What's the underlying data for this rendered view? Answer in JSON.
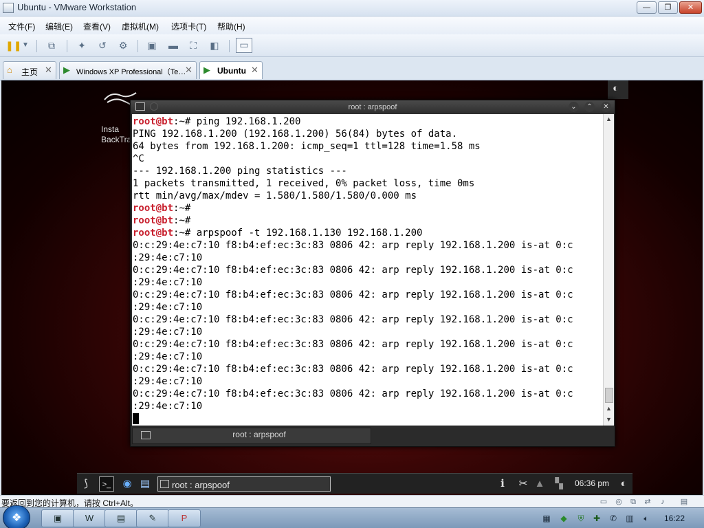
{
  "window": {
    "title": "Ubuntu - VMware Workstation",
    "minimize_glyph": "—",
    "maximize_glyph": "❐",
    "close_glyph": "✕"
  },
  "menu": [
    "文件(F)",
    "编辑(E)",
    "查看(V)",
    "虚拟机(M)",
    "选项卡(T)",
    "帮助(H)"
  ],
  "toolbar": {
    "icons": [
      "pause-icon",
      "dropdown-icon",
      "network-icon",
      "snapshot-icon",
      "revert-snapshot-icon",
      "snapshot-manager-icon",
      "sidebar-icon",
      "console-view-icon",
      "fullscreen-icon",
      "unity-icon",
      "thumbnail-icon"
    ]
  },
  "tabs": [
    {
      "label": "主页",
      "icon": "home-icon",
      "close": "✕"
    },
    {
      "label": "Windows XP Professional（Te…",
      "icon": "vm-icon",
      "close": "✕"
    },
    {
      "label": "Ubuntu",
      "icon": "vm-icon",
      "close": "✕",
      "active": true
    }
  ],
  "desktop": {
    "label_line1": "Insta",
    "label_line2": "BackTra"
  },
  "terminal": {
    "title": "root : arpspoof",
    "tab_label": "root : arpspoof",
    "lines": [
      {
        "prompt": "root@bt",
        "rest": ":~# ping 192.168.1.200"
      },
      {
        "text": "PING 192.168.1.200 (192.168.1.200) 56(84) bytes of data."
      },
      {
        "text": "64 bytes from 192.168.1.200: icmp_seq=1 ttl=128 time=1.58 ms"
      },
      {
        "text": "^C"
      },
      {
        "text": "--- 192.168.1.200 ping statistics ---"
      },
      {
        "text": "1 packets transmitted, 1 received, 0% packet loss, time 0ms"
      },
      {
        "text": "rtt min/avg/max/mdev = 1.580/1.580/1.580/0.000 ms"
      },
      {
        "prompt": "root@bt",
        "rest": ":~#"
      },
      {
        "prompt": "root@bt",
        "rest": ":~#"
      },
      {
        "prompt": "root@bt",
        "rest": ":~# arpspoof -t 192.168.1.130 192.168.1.200"
      },
      {
        "text": "0:c:29:4e:c7:10 f8:b4:ef:ec:3c:83 0806 42: arp reply 192.168.1.200 is-at 0:c"
      },
      {
        "text": ":29:4e:c7:10"
      },
      {
        "text": "0:c:29:4e:c7:10 f8:b4:ef:ec:3c:83 0806 42: arp reply 192.168.1.200 is-at 0:c"
      },
      {
        "text": ":29:4e:c7:10"
      },
      {
        "text": "0:c:29:4e:c7:10 f8:b4:ef:ec:3c:83 0806 42: arp reply 192.168.1.200 is-at 0:c"
      },
      {
        "text": ":29:4e:c7:10"
      },
      {
        "text": "0:c:29:4e:c7:10 f8:b4:ef:ec:3c:83 0806 42: arp reply 192.168.1.200 is-at 0:c"
      },
      {
        "text": ":29:4e:c7:10"
      },
      {
        "text": "0:c:29:4e:c7:10 f8:b4:ef:ec:3c:83 0806 42: arp reply 192.168.1.200 is-at 0:c"
      },
      {
        "text": ":29:4e:c7:10"
      },
      {
        "text": "0:c:29:4e:c7:10 f8:b4:ef:ec:3c:83 0806 42: arp reply 192.168.1.200 is-at 0:c"
      },
      {
        "text": ":29:4e:c7:10"
      },
      {
        "text": "0:c:29:4e:c7:10 f8:b4:ef:ec:3c:83 0806 42: arp reply 192.168.1.200 is-at 0:c"
      },
      {
        "text": ":29:4e:c7:10"
      }
    ],
    "prompt_color": "#c8202e"
  },
  "guest_panel": {
    "task_label": "root : arpspoof",
    "clock": "06:36 pm"
  },
  "statusbar": {
    "text": "要返回到您的计算机，请按 Ctrl+Alt。"
  },
  "taskbar": {
    "apps": [
      "explorer-icon",
      "word-icon",
      "folder-icon",
      "notes-icon",
      "powerpoint-icon"
    ],
    "clock": "16:22"
  }
}
